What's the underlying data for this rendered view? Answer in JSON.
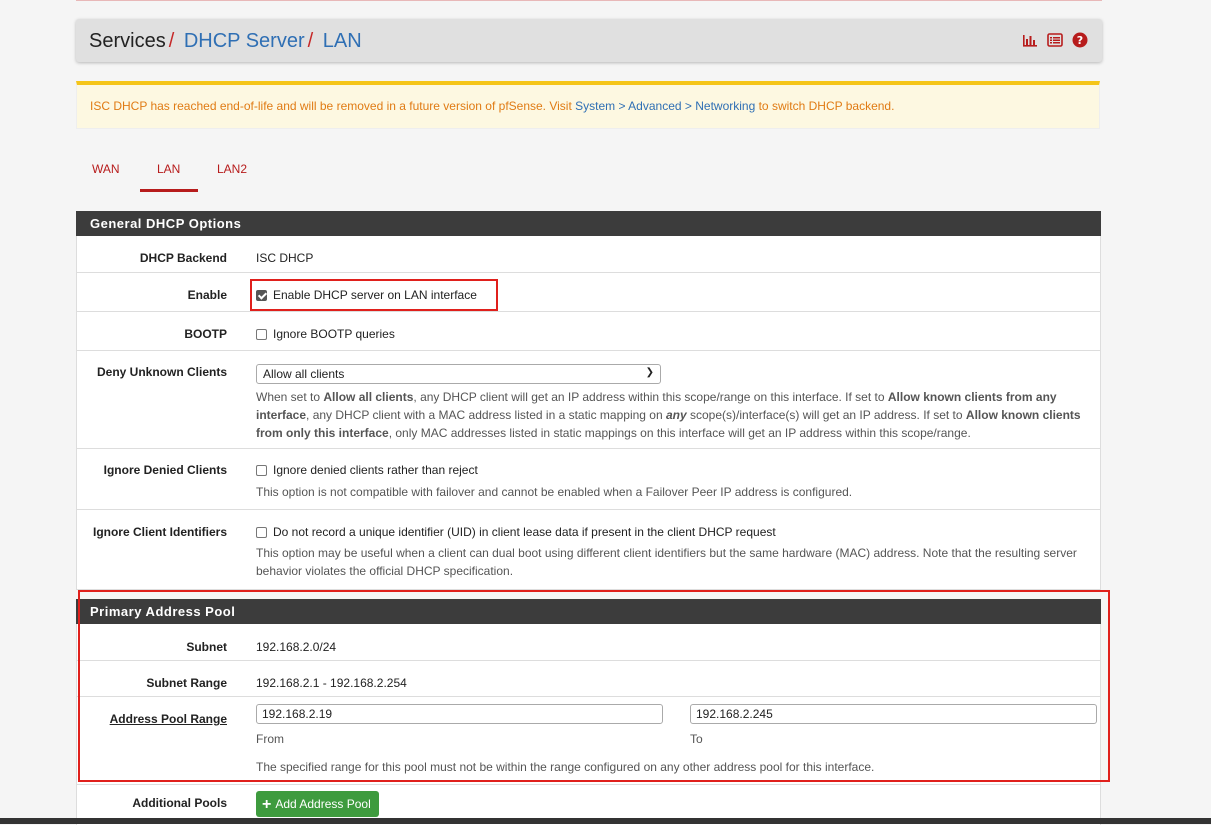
{
  "breadcrumb": {
    "root": "Services",
    "sep": "/",
    "item1": "DHCP Server",
    "item2": "LAN"
  },
  "header_icons": [
    "bar-chart-icon",
    "list-icon",
    "help-icon"
  ],
  "alert": {
    "text_before": "ISC DHCP has reached end-of-life and will be removed in a future version of pfSense. Visit ",
    "link1": "System",
    "sep": " > ",
    "link2": "Advanced",
    "link3": "Networking",
    "text_after": " to switch DHCP backend."
  },
  "tabs": [
    {
      "label": "WAN"
    },
    {
      "label": "LAN"
    },
    {
      "label": "LAN2"
    }
  ],
  "general": {
    "title": "General DHCP Options",
    "backend_label": "DHCP Backend",
    "backend_value": "ISC DHCP",
    "enable_label": "Enable",
    "enable_text": "Enable DHCP server on LAN interface",
    "bootp_label": "BOOTP",
    "bootp_text": "Ignore BOOTP queries",
    "deny_label": "Deny Unknown Clients",
    "deny_value": "Allow all clients",
    "deny_help": {
      "p1": "When set to ",
      "b1": "Allow all clients",
      "p2": ", any DHCP client will get an IP address within this scope/range on this interface. If set to ",
      "b2": "Allow known clients from any interface",
      "p3": ", any DHCP client with a MAC address listed in a static mapping on ",
      "b3": "any",
      "p4": " scope(s)/interface(s) will get an IP address. If set to ",
      "b4": "Allow known clients from only this interface",
      "p5": ", only MAC addresses listed in static mappings on this interface will get an IP address within this scope/range."
    },
    "ignore_denied_label": "Ignore Denied Clients",
    "ignore_denied_text": "Ignore denied clients rather than reject",
    "ignore_denied_help": "This option is not compatible with failover and cannot be enabled when a Failover Peer IP address is configured.",
    "ignore_uid_label": "Ignore Client Identifiers",
    "ignore_uid_text": "Do not record a unique identifier (UID) in client lease data if present in the client DHCP request",
    "ignore_uid_help": "This option may be useful when a client can dual boot using different client identifiers but the same hardware (MAC) address. Note that the resulting server behavior violates the official DHCP specification."
  },
  "pool": {
    "title": "Primary Address Pool",
    "subnet_label": "Subnet",
    "subnet_value": "192.168.2.0/24",
    "range_label": "Subnet Range",
    "range_value": "192.168.2.1 - 192.168.2.254",
    "pool_label": "Address Pool Range",
    "from_value": "192.168.2.19",
    "to_value": "192.168.2.245",
    "from_label": "From",
    "to_label": "To",
    "pool_help": "The specified range for this pool must not be within the range configured on any other address pool for this interface.",
    "additional_label": "Additional Pools",
    "add_button": "Add Address Pool"
  },
  "colors": {
    "accent_red": "#b71c1c",
    "link_blue": "#2f6fb4",
    "alert_orange": "#e07b14",
    "add_green": "#3e9b3e"
  }
}
